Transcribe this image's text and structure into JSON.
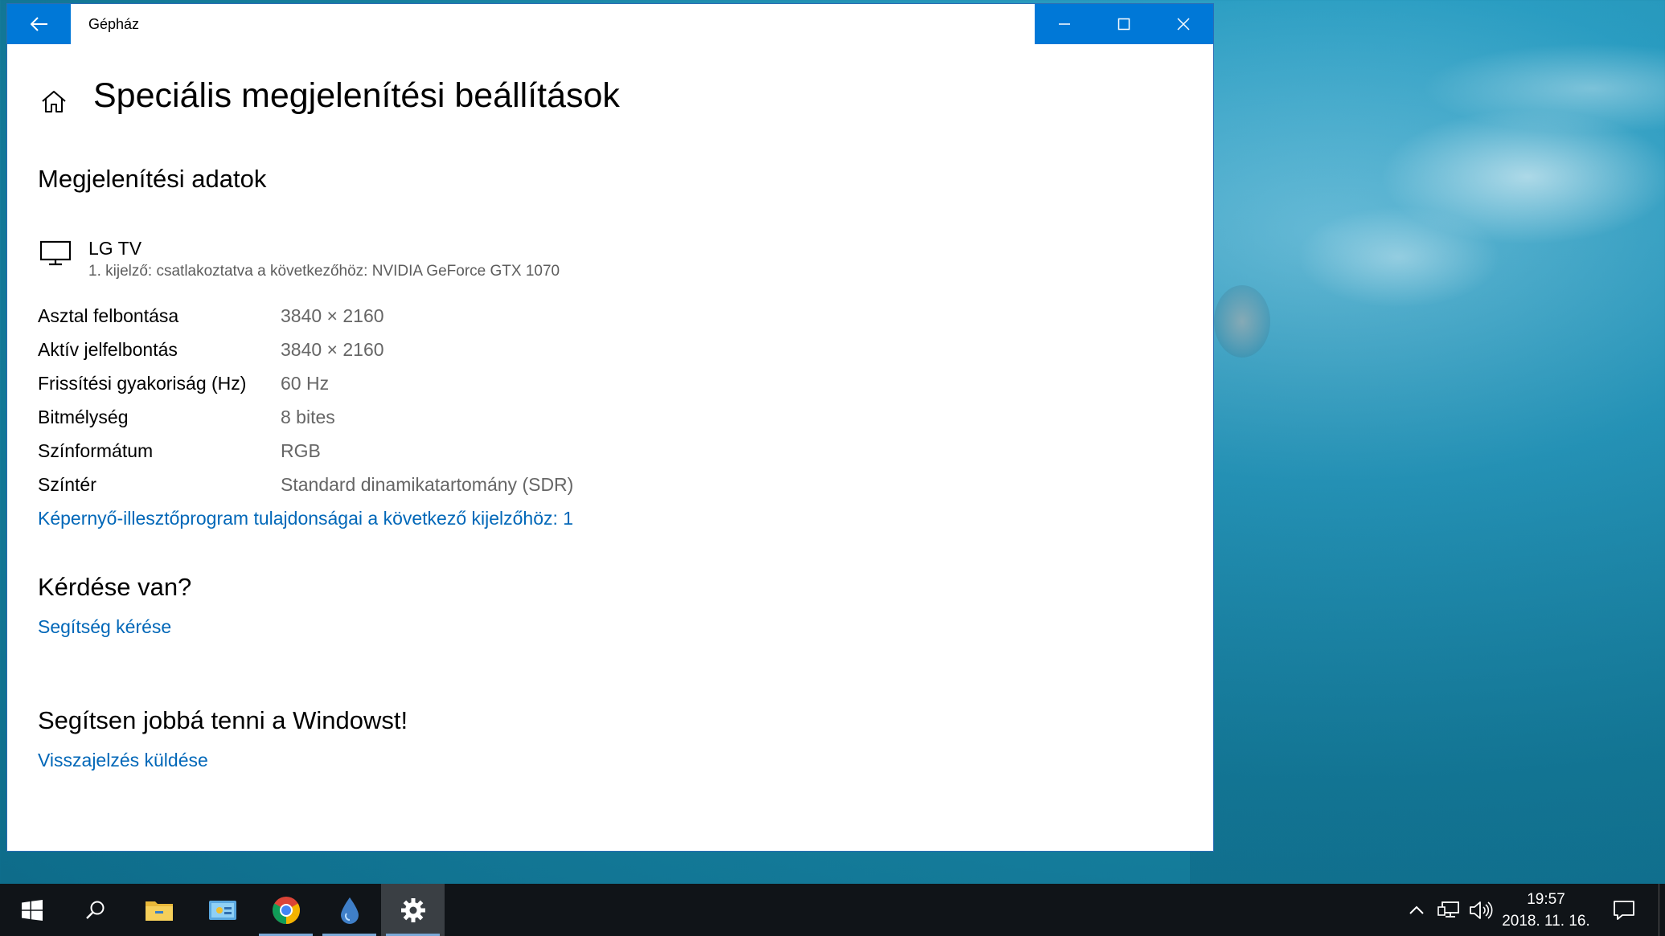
{
  "window": {
    "app_title": "Gépház",
    "page_title": "Speciális megjelenítési beállítások"
  },
  "display_info": {
    "heading": "Megjelenítési adatok",
    "name": "LG TV",
    "subtitle": "1. kijelző: csatlakoztatva a következőhöz: NVIDIA GeForce GTX 1070",
    "specs": [
      {
        "label": "Asztal felbontása",
        "value": "3840 × 2160"
      },
      {
        "label": "Aktív jelfelbontás",
        "value": "3840 × 2160"
      },
      {
        "label": "Frissítési gyakoriság (Hz)",
        "value": "60 Hz"
      },
      {
        "label": "Bitmélység",
        "value": "8 bites"
      },
      {
        "label": "Színformátum",
        "value": "RGB"
      },
      {
        "label": "Színtér",
        "value": "Standard dinamikatartomány (SDR)"
      }
    ],
    "adapter_link": "Képernyő-illesztőprogram tulajdonságai a következő kijelzőhöz: 1"
  },
  "help": {
    "heading": "Kérdése van?",
    "link": "Segítség kérése"
  },
  "feedback": {
    "heading": "Segítsen jobbá tenni a Windowst!",
    "link": "Visszajelzés küldése"
  },
  "taskbar": {
    "items": [
      "start-icon",
      "search-icon",
      "file-explorer-icon",
      "control-panel-icon",
      "chrome-icon",
      "droplet-app-icon",
      "settings-icon"
    ],
    "active_item": "settings-icon",
    "clock_time": "19:57",
    "clock_date": "2018. 11. 16."
  },
  "colors": {
    "accent": "#0078d7",
    "link": "#0067b8",
    "taskbar": "#101418"
  }
}
